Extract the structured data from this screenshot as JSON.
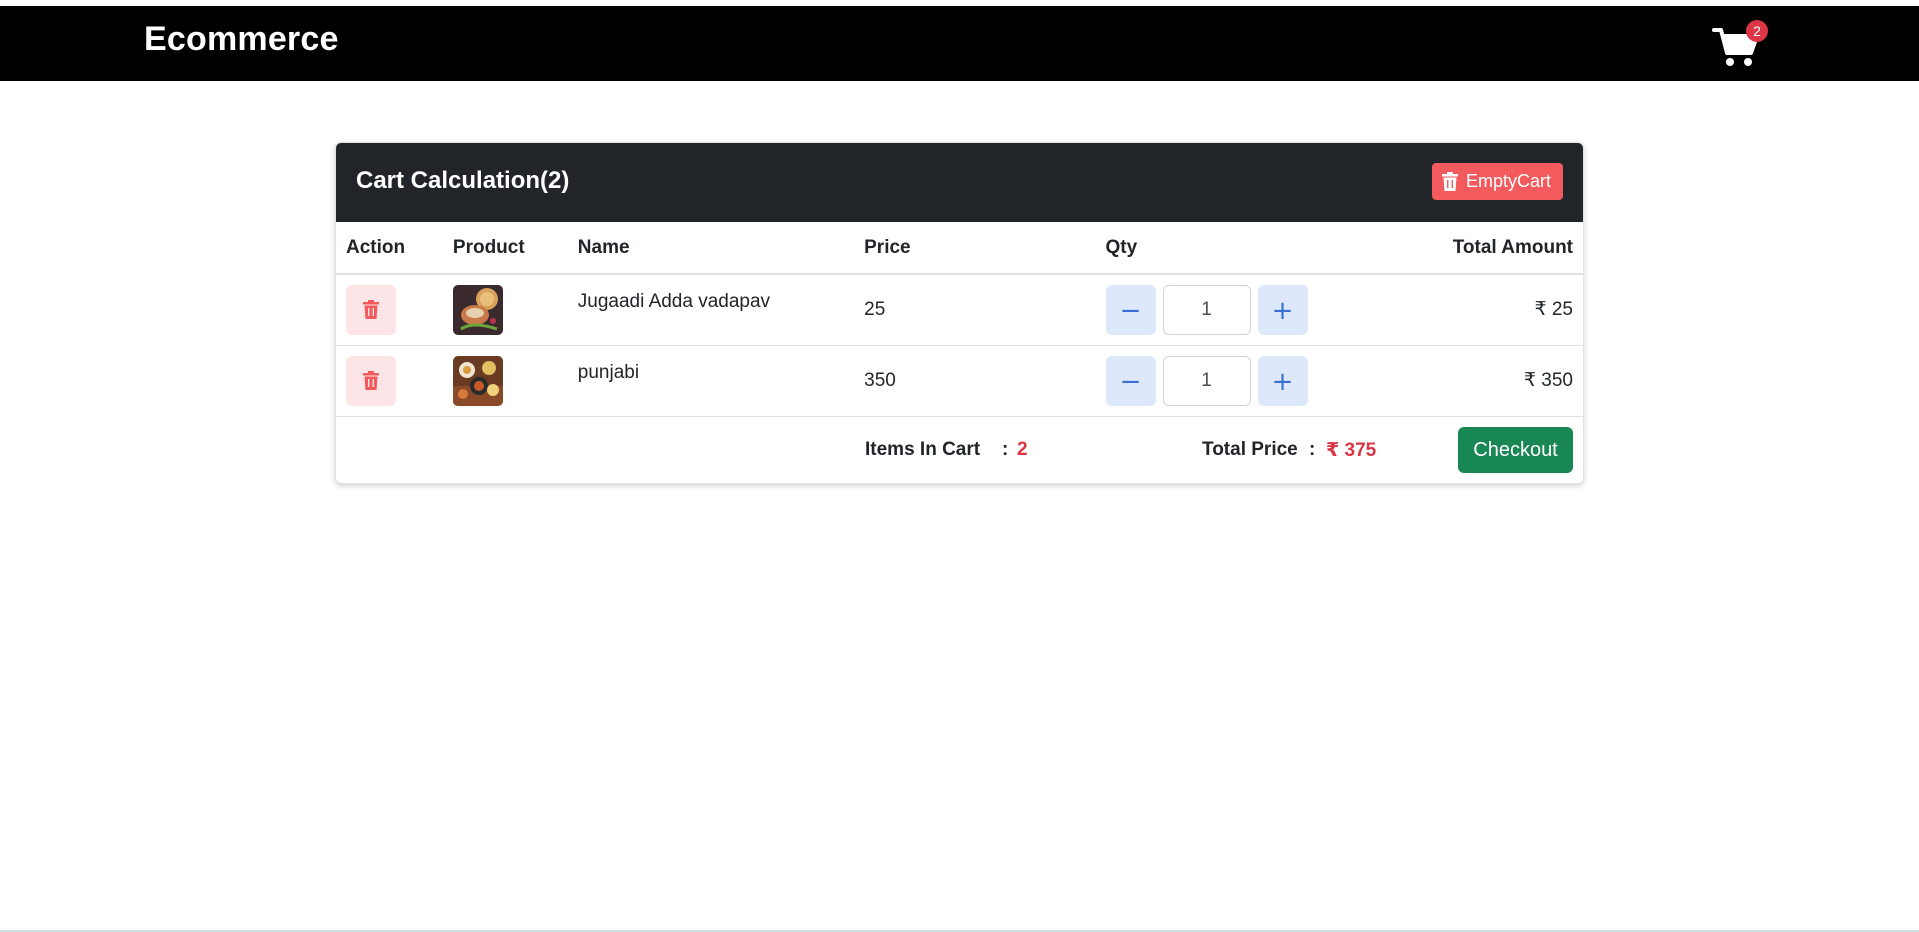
{
  "navbar": {
    "brand": "Ecommerce",
    "cart_icon": "shopping-cart-icon",
    "cart_count": "2"
  },
  "cart": {
    "title": "Cart Calculation(2)",
    "empty_button": "EmptyCart",
    "empty_icon": "trash-icon",
    "columns": [
      "Action",
      "Product",
      "Name",
      "Price",
      "Qty",
      "Total Amount"
    ],
    "items": [
      {
        "name": "Jugaadi Adda vadapav",
        "price": "25",
        "qty": "1",
        "total": "₹ 25",
        "image": "vadapav-thumbnail"
      },
      {
        "name": "punjabi",
        "price": "350",
        "qty": "1",
        "total": "₹ 350",
        "image": "punjabi-thali-thumbnail"
      }
    ],
    "summary": {
      "items_label": "Items In Cart",
      "items_count": "2",
      "total_label": "Total Price",
      "total_value": "₹ 375",
      "checkout": "Checkout"
    }
  },
  "colors": {
    "navbar_bg": "#000000",
    "card_header_bg": "#212529",
    "danger": "#dc3545",
    "success": "#198754",
    "qty_button_bg": "#dde8fb"
  }
}
